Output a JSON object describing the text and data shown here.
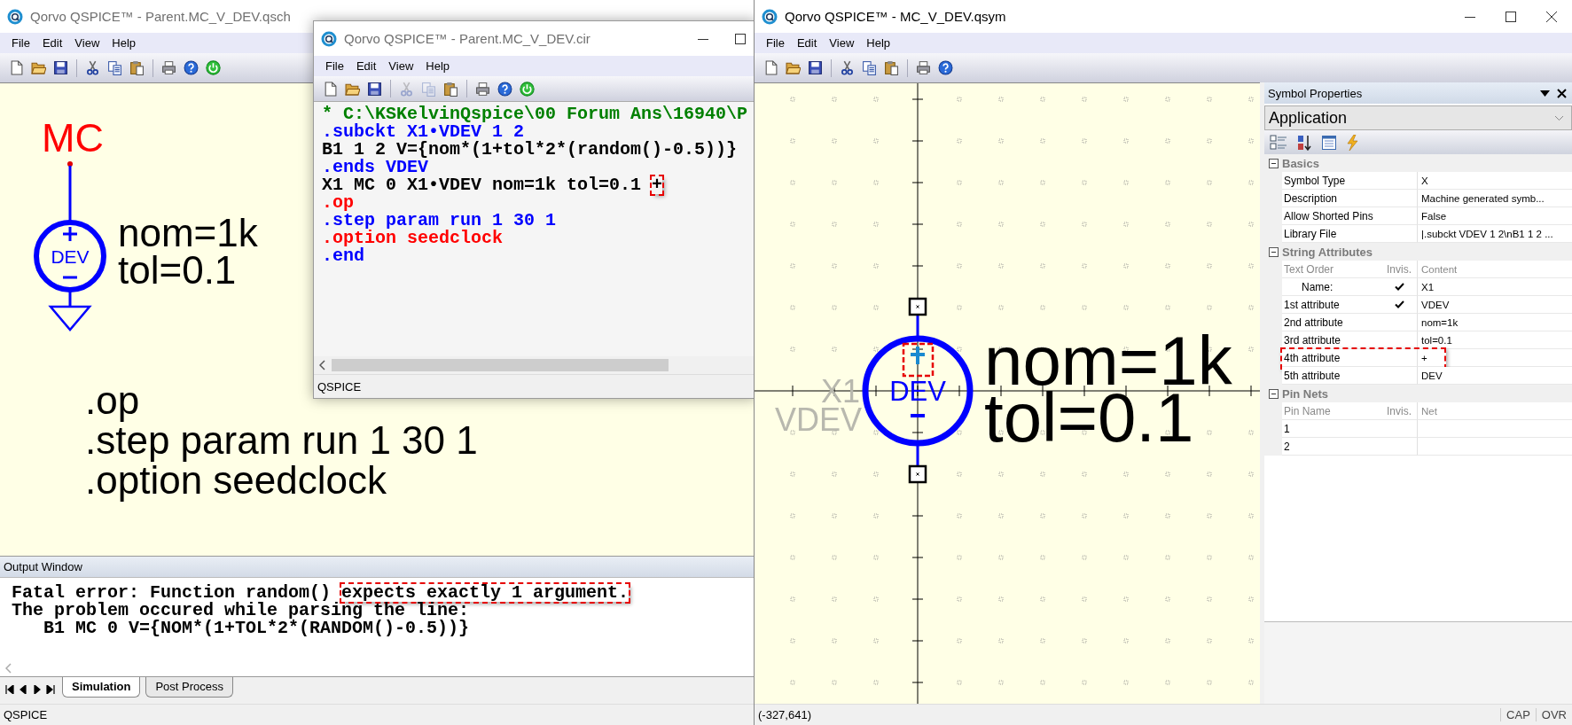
{
  "schematic_window": {
    "title": "Qorvo QSPICE™ - Parent.MC_V_DEV.qsch",
    "active": false,
    "menu": [
      "File",
      "Edit",
      "View",
      "Help"
    ],
    "toolbar": [
      {
        "kind": "new",
        "disabled": false
      },
      {
        "kind": "open",
        "disabled": false
      },
      {
        "kind": "save",
        "disabled": false
      },
      {
        "kind": "separator"
      },
      {
        "kind": "cut",
        "disabled": false
      },
      {
        "kind": "copy",
        "disabled": false
      },
      {
        "kind": "paste",
        "disabled": false
      },
      {
        "kind": "separator"
      },
      {
        "kind": "print",
        "disabled": false
      },
      {
        "kind": "help",
        "disabled": false
      },
      {
        "kind": "power",
        "disabled": false
      }
    ],
    "canvas": {
      "net_label": "MC",
      "symbol_text": "DEV",
      "params": [
        "nom=1k",
        "tol=0.1"
      ],
      "directives": [
        ".op",
        ".step param run 1 30 1",
        ".option seedclock"
      ]
    },
    "output_window": {
      "title": "Output Window",
      "lines": [
        {
          "segments": [
            {
              "text": "Fatal error: Function random() ",
              "highlighted": false
            },
            {
              "text": "expects exactly 1 argument.",
              "highlighted": true
            }
          ]
        },
        {
          "segments": [
            {
              "text": "The problem occured while parsing the line:",
              "highlighted": false
            }
          ]
        },
        {
          "segments": [
            {
              "text": "   B1 MC 0 V={NOM*(1+TOL*2*(RANDOM()-0.5))}",
              "highlighted": false
            }
          ]
        }
      ]
    },
    "tabs": [
      {
        "label": "Simulation",
        "selected": true
      },
      {
        "label": "Post Process",
        "selected": false
      }
    ],
    "status": "QSPICE"
  },
  "netlist_window": {
    "title": "Qorvo QSPICE™ - Parent.MC_V_DEV.cir",
    "active": false,
    "menu": [
      "File",
      "Edit",
      "View",
      "Help"
    ],
    "toolbar": [
      {
        "kind": "new",
        "disabled": false
      },
      {
        "kind": "open",
        "disabled": false
      },
      {
        "kind": "save",
        "disabled": false
      },
      {
        "kind": "separator"
      },
      {
        "kind": "cut",
        "disabled": true
      },
      {
        "kind": "copy",
        "disabled": true
      },
      {
        "kind": "paste",
        "disabled": false
      },
      {
        "kind": "separator"
      },
      {
        "kind": "print",
        "disabled": false
      },
      {
        "kind": "help",
        "disabled": false
      },
      {
        "kind": "power",
        "disabled": false
      }
    ],
    "lines": [
      {
        "color": "#008000",
        "segments": [
          {
            "text": "* C:\\KSKelvinQspice\\00 Forum Ans\\16940\\P",
            "highlighted": false
          }
        ]
      },
      {
        "color": "#0000ff",
        "segments": [
          {
            "text": ".subckt X1•VDEV 1 2",
            "highlighted": false
          }
        ]
      },
      {
        "color": "#000000",
        "segments": [
          {
            "text": "B1 1 2 V={nom*(1+tol*2*(random()-0.5))}",
            "highlighted": false
          }
        ]
      },
      {
        "color": "#0000ff",
        "segments": [
          {
            "text": ".ends VDEV",
            "highlighted": false
          }
        ]
      },
      {
        "color": "#000000",
        "segments": [
          {
            "text": "X1 MC 0 X1•VDEV nom=1k tol=0.1 ",
            "highlighted": false
          },
          {
            "text": "+",
            "highlighted": true
          }
        ]
      },
      {
        "color": "#ff0000",
        "segments": [
          {
            "text": ".op",
            "highlighted": false
          }
        ]
      },
      {
        "color": "#0000ff",
        "segments": [
          {
            "text": ".step param run 1 30 1",
            "highlighted": false
          }
        ]
      },
      {
        "color": "#ff0000",
        "segments": [
          {
            "text": ".option seedclock",
            "highlighted": false
          }
        ]
      },
      {
        "color": "#0000ff",
        "segments": [
          {
            "text": ".end",
            "highlighted": false
          }
        ]
      }
    ],
    "status": "QSPICE"
  },
  "symbol_window": {
    "title": "Qorvo QSPICE™ - MC_V_DEV.qsym",
    "active": true,
    "menu": [
      "File",
      "Edit",
      "View",
      "Help"
    ],
    "toolbar": [
      {
        "kind": "new",
        "disabled": false
      },
      {
        "kind": "open",
        "disabled": false
      },
      {
        "kind": "save",
        "disabled": false
      },
      {
        "kind": "separator"
      },
      {
        "kind": "cut",
        "disabled": false
      },
      {
        "kind": "copy",
        "disabled": false
      },
      {
        "kind": "paste",
        "disabled": false
      },
      {
        "kind": "separator"
      },
      {
        "kind": "print",
        "disabled": false
      },
      {
        "kind": "help",
        "disabled": false
      }
    ],
    "canvas": {
      "instance_name": "X1",
      "model_name": "VDEV",
      "symbol_text": "DEV",
      "params": [
        "nom=1k",
        "tol=0.1"
      ],
      "plus_highlighted": true
    },
    "properties": {
      "title": "Symbol Properties",
      "object": "Application",
      "sections": [
        {
          "title": "Basics",
          "expanded": true,
          "rows": [
            {
              "label": "Symbol Type",
              "value": "X"
            },
            {
              "label": "Description",
              "value": "Machine generated symb..."
            },
            {
              "label": "Allow Shorted Pins",
              "value": "False"
            },
            {
              "label": "Library File",
              "value": "|.subckt VDEV 1 2\\nB1 1 2 ..."
            }
          ]
        },
        {
          "title": "String Attributes",
          "expanded": true,
          "columns": [
            "Text Order",
            "Invis.",
            "Content"
          ],
          "rows": [
            {
              "label": "Name:",
              "indented": true,
              "invisible": true,
              "value": "X1",
              "highlighted": false
            },
            {
              "label": "1st attribute",
              "invisible": true,
              "value": "VDEV",
              "highlighted": false
            },
            {
              "label": "2nd attribute",
              "invisible": false,
              "value": "nom=1k",
              "highlighted": false
            },
            {
              "label": "3rd attribute",
              "invisible": false,
              "value": "tol=0.1",
              "highlighted": false
            },
            {
              "label": "4th attribute",
              "invisible": false,
              "value": "+",
              "highlighted": true
            },
            {
              "label": "5th attribute",
              "invisible": false,
              "value": "DEV",
              "highlighted": false
            }
          ]
        },
        {
          "title": "Pin Nets",
          "expanded": true,
          "columns": [
            "Pin Name",
            "Invis.",
            "Net"
          ],
          "rows": [
            {
              "label": "1",
              "invisible": false
            },
            {
              "label": "2",
              "invisible": false
            }
          ]
        }
      ]
    },
    "status": {
      "coordinates": "(-327,641)",
      "indicators": [
        "CAP",
        "OVR"
      ]
    }
  }
}
